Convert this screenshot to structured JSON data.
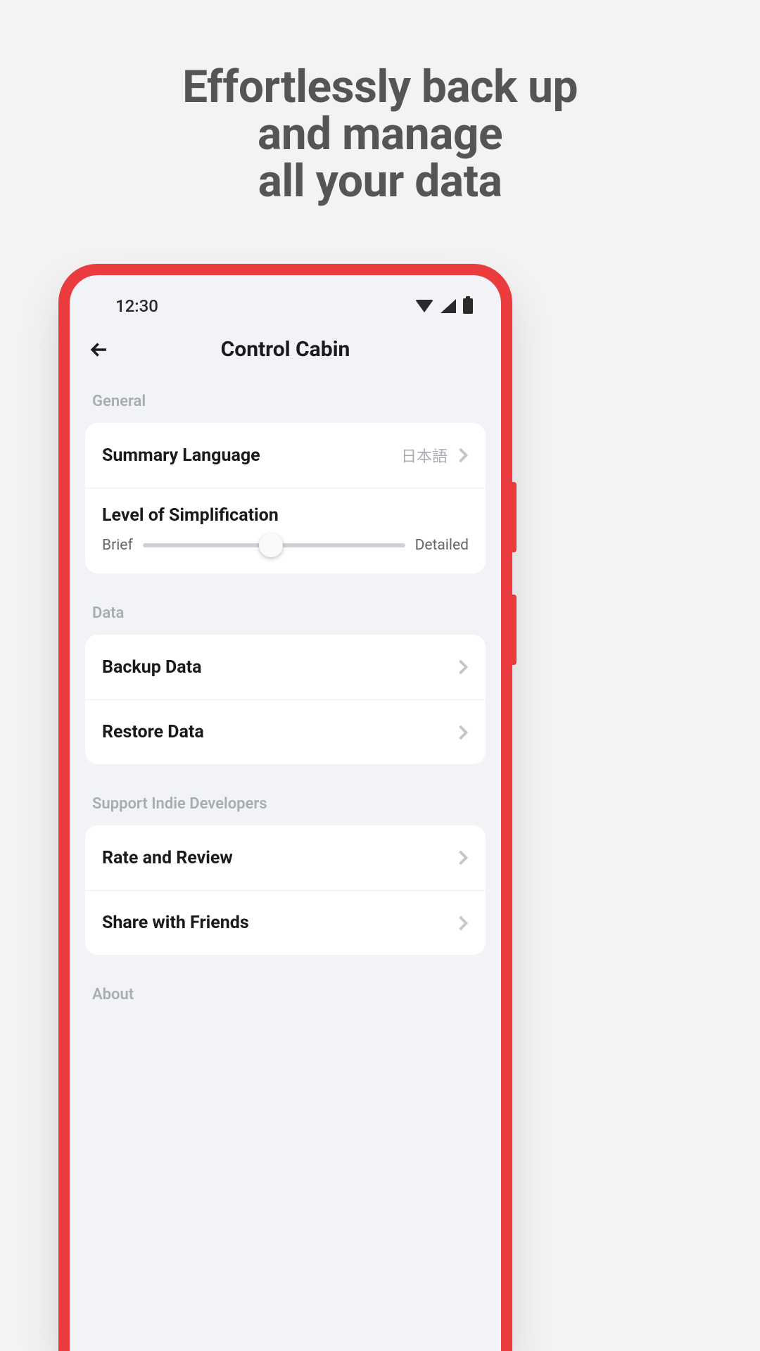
{
  "headline": {
    "line1": "Effortlessly back up",
    "line2": "and manage",
    "line3": "all your data"
  },
  "status": {
    "time": "12:30"
  },
  "nav": {
    "title": "Control Cabin"
  },
  "sections": {
    "general": {
      "label": "General",
      "summary_language": {
        "title": "Summary Language",
        "value": "日本語"
      },
      "simplification": {
        "title": "Level of Simplification",
        "min_label": "Brief",
        "max_label": "Detailed",
        "value": 0.49
      }
    },
    "data": {
      "label": "Data",
      "backup": {
        "title": "Backup Data"
      },
      "restore": {
        "title": "Restore Data"
      }
    },
    "support": {
      "label": "Support Indie Developers",
      "rate": {
        "title": "Rate and Review"
      },
      "share": {
        "title": "Share with Friends"
      }
    },
    "about": {
      "label": "About"
    }
  }
}
